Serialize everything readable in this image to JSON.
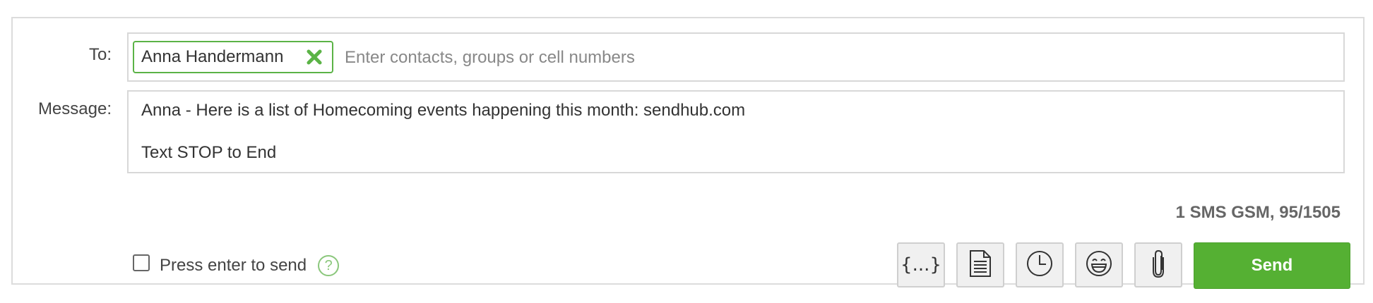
{
  "form": {
    "to_label": "To:",
    "message_label": "Message:"
  },
  "recipients": {
    "chips": [
      {
        "name": "Anna Handermann"
      }
    ],
    "placeholder": "Enter contacts, groups or cell numbers",
    "chip_remove_icon": "x-icon"
  },
  "message": {
    "line1": "Anna - Here is a list of Homecoming events happening this month: sendhub.com",
    "line2": "Text STOP to End"
  },
  "counter": "1 SMS GSM, 95/1505",
  "options": {
    "enter_to_send_label": "Press enter to send",
    "enter_to_send_checked": false,
    "help_icon_glyph": "?"
  },
  "toolbar": {
    "template_label": "{...}",
    "icons": [
      "template-icon",
      "document-icon",
      "clock-icon",
      "emoji-icon",
      "paperclip-icon"
    ],
    "send_label": "Send"
  },
  "colors": {
    "accent": "#55b033",
    "chip_border": "#5bb346",
    "help": "#8bc77c"
  }
}
